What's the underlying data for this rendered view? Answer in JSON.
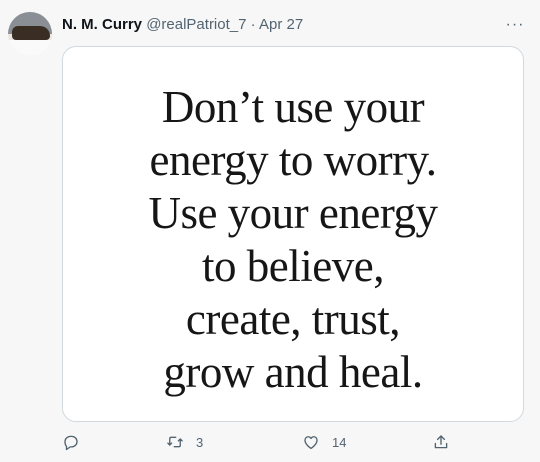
{
  "tweet": {
    "author_name": "N. M. Curry",
    "handle": "@realPatriot_7",
    "separator": "·",
    "date": "Apr 27",
    "more_icon": "···",
    "image_text": [
      "Don’t use your",
      "energy to worry.",
      "Use your energy",
      "to believe,",
      "create, trust,",
      "grow and heal."
    ],
    "retweet_count": "3",
    "like_count": "14"
  }
}
